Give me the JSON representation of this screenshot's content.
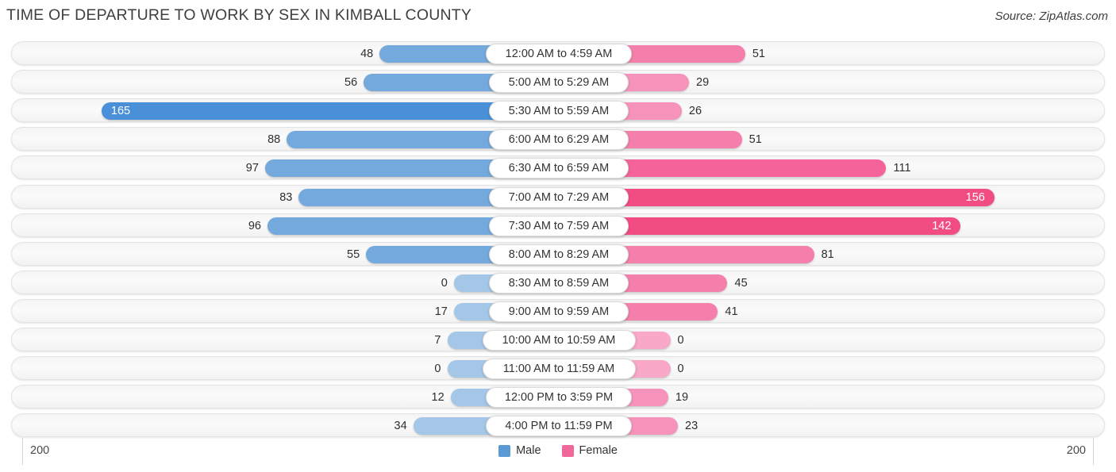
{
  "header": {
    "title": "TIME OF DEPARTURE TO WORK BY SEX IN KIMBALL COUNTY",
    "source": "Source: ZipAtlas.com"
  },
  "legend": {
    "male_label": "Male",
    "female_label": "Female",
    "male_color": "#5b9bd5",
    "female_color": "#f2679a"
  },
  "axis": {
    "left_tick": "200",
    "right_tick": "200"
  },
  "chart_data": {
    "type": "bar",
    "title": "TIME OF DEPARTURE TO WORK BY SEX IN KIMBALL COUNTY",
    "orientation": "horizontal-diverging",
    "xlabel": "",
    "ylabel": "",
    "xlim": [
      200,
      200
    ],
    "grid": false,
    "legend_position": "bottom-center",
    "categories": [
      "12:00 AM to 4:59 AM",
      "5:00 AM to 5:29 AM",
      "5:30 AM to 5:59 AM",
      "6:00 AM to 6:29 AM",
      "6:30 AM to 6:59 AM",
      "7:00 AM to 7:29 AM",
      "7:30 AM to 7:59 AM",
      "8:00 AM to 8:29 AM",
      "8:30 AM to 8:59 AM",
      "9:00 AM to 9:59 AM",
      "10:00 AM to 10:59 AM",
      "11:00 AM to 11:59 AM",
      "12:00 PM to 3:59 PM",
      "4:00 PM to 11:59 PM"
    ],
    "series": [
      {
        "name": "Male",
        "values": [
          48,
          56,
          165,
          88,
          97,
          83,
          96,
          55,
          0,
          17,
          7,
          0,
          12,
          34
        ]
      },
      {
        "name": "Female",
        "values": [
          51,
          29,
          26,
          51,
          111,
          156,
          142,
          81,
          45,
          41,
          0,
          0,
          19,
          23
        ]
      }
    ]
  }
}
